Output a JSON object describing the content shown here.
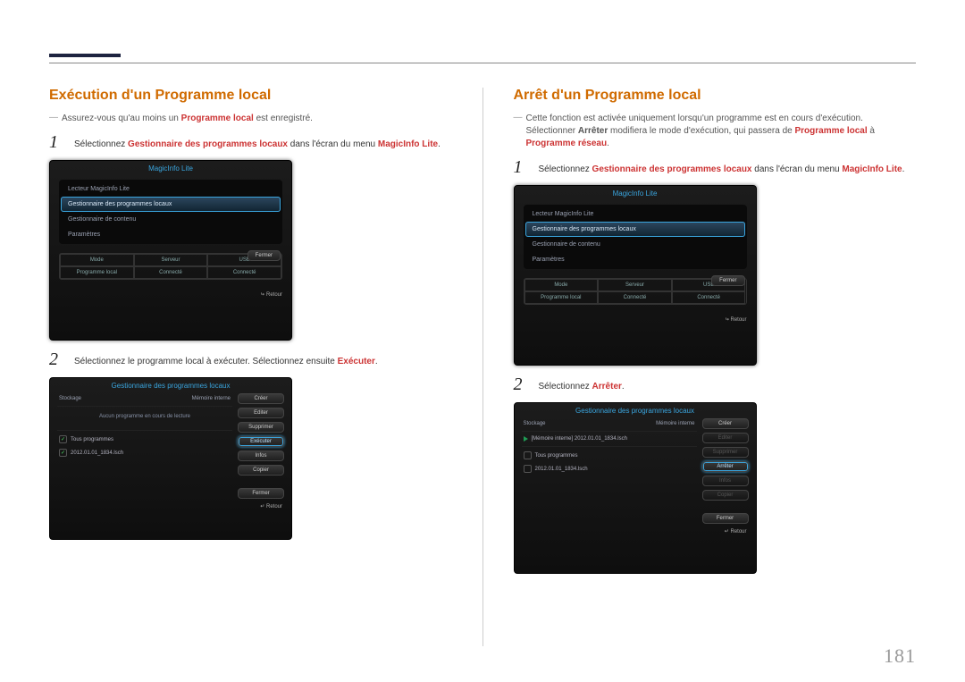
{
  "page_number": "181",
  "left": {
    "heading": "Exécution d'un Programme local",
    "note_prefix": "Assurez-vous qu'au moins un ",
    "note_bold": "Programme local",
    "note_suffix": " est enregistré.",
    "step1": {
      "num": "1",
      "t1": "Sélectionnez ",
      "t2": "Gestionnaire des programmes locaux",
      "t3": " dans l'écran du menu ",
      "t4": "MagicInfo Lite",
      "t5": "."
    },
    "shotA": {
      "title": "MagicInfo Lite",
      "items": [
        "Lecteur MagicInfo Lite",
        "Gestionnaire des programmes locaux",
        "Gestionnaire de contenu",
        "Paramètres"
      ],
      "close": "Fermer",
      "grid_h": [
        "Mode",
        "Serveur",
        "USB"
      ],
      "grid_v": [
        "Programme local",
        "Connecté",
        "Connecté"
      ],
      "retour": "Retour"
    },
    "step2": {
      "num": "2",
      "t1": "Sélectionnez le programme local à exécuter. Sélectionnez ensuite ",
      "t2": "Exécuter",
      "t3": "."
    },
    "shotB": {
      "title": "Gestionnaire des programmes locaux",
      "storage": "Stockage",
      "mem": "Mémoire interne",
      "msg": "Aucun programme en cours de lecture",
      "all": "Tous programmes",
      "file": "2012.01.01_1834.lsch",
      "btn_create": "Créer",
      "btn_edit": "Editer",
      "btn_delete": "Supprimer",
      "btn_run": "Exécuter",
      "btn_info": "Infos",
      "btn_copy": "Copier",
      "btn_close": "Fermer",
      "retour": "Retour"
    }
  },
  "right": {
    "heading": "Arrêt d'un Programme local",
    "note_l1": "Cette fonction est activée uniquement lorsqu'un programme est en cours d'exécution.",
    "note_l2a": "Sélectionner ",
    "note_l2b": "Arrêter",
    "note_l2c": " modifiera le mode d'exécution, qui passera de ",
    "note_l2d": "Programme local",
    "note_l2e": " à ",
    "note_l3": "Programme réseau",
    "note_l3b": ".",
    "step1": {
      "num": "1",
      "t1": "Sélectionnez ",
      "t2": "Gestionnaire des programmes locaux",
      "t3": " dans l'écran du menu ",
      "t4": "MagicInfo Lite",
      "t5": "."
    },
    "shotA": {
      "title": "MagicInfo Lite",
      "items": [
        "Lecteur MagicInfo Lite",
        "Gestionnaire des programmes locaux",
        "Gestionnaire de contenu",
        "Paramètres"
      ],
      "close": "Fermer",
      "grid_h": [
        "Mode",
        "Serveur",
        "USB"
      ],
      "grid_v": [
        "Programme local",
        "Connecté",
        "Connecté"
      ],
      "retour": "Retour"
    },
    "step2": {
      "num": "2",
      "t1": "Sélectionnez ",
      "t2": "Arrêter",
      "t3": "."
    },
    "shotB": {
      "title": "Gestionnaire des programmes locaux",
      "storage": "Stockage",
      "mem": "Mémoire interne",
      "file_playing": "[Mémoire interne] 2012.01.01_1834.lsch",
      "all": "Tous programmes",
      "file": "2012.01.01_1834.lsch",
      "btn_create": "Créer",
      "btn_edit": "Editer",
      "btn_delete": "Supprimer",
      "btn_stop": "Arrêter",
      "btn_info": "Infos",
      "btn_copy": "Copier",
      "btn_close": "Fermer",
      "retour": "Retour"
    }
  }
}
